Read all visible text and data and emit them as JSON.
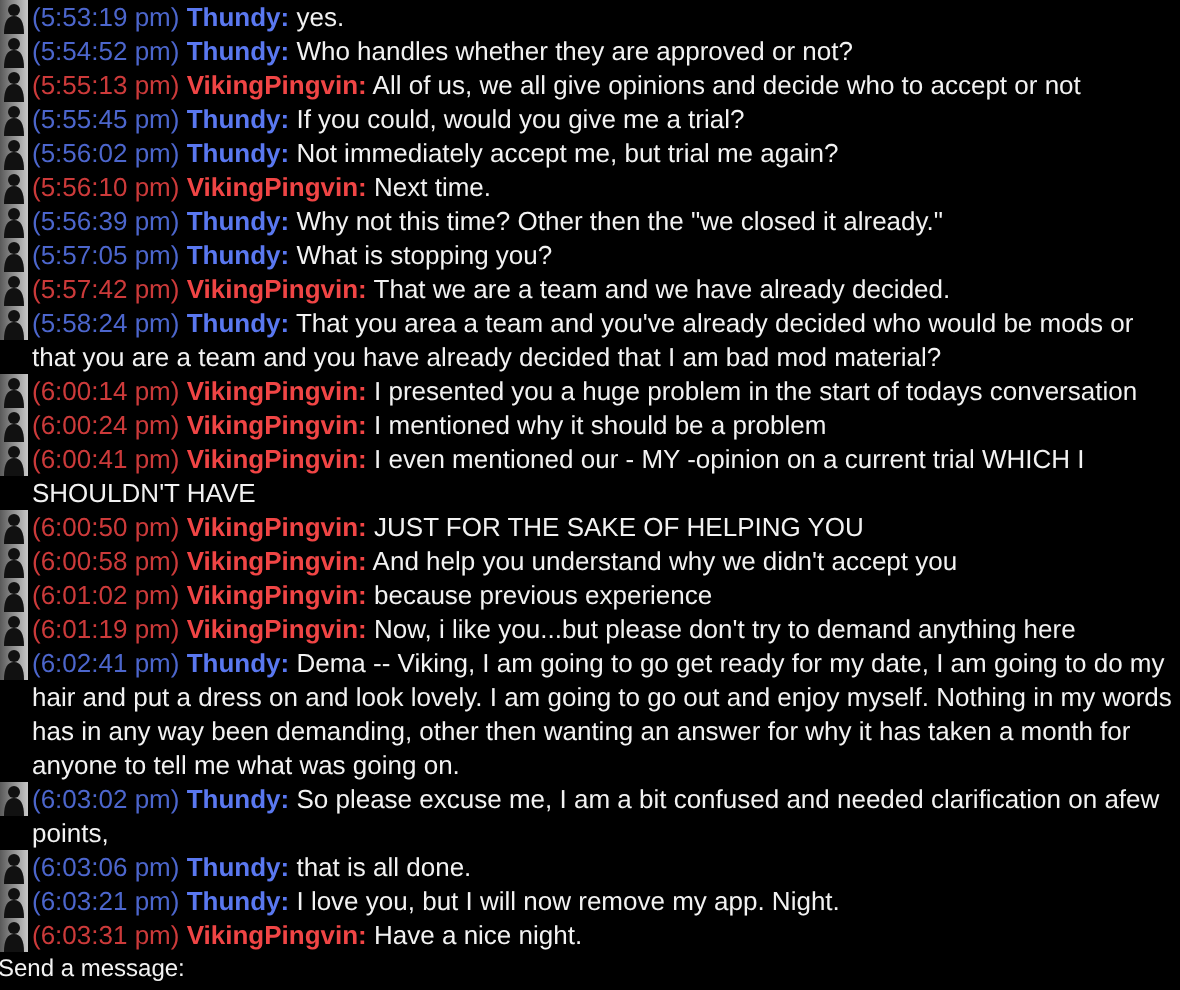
{
  "messages": [
    {
      "time": "(5:53:19 pm)",
      "sender": "Thundy:",
      "color": "#5a78f0",
      "text": "yes."
    },
    {
      "time": "(5:54:52 pm)",
      "sender": "Thundy:",
      "color": "#5a78f0",
      "text": "Who handles whether they are approved or not?"
    },
    {
      "time": "(5:55:13 pm)",
      "sender": "VikingPingvin:",
      "color": "#f04545",
      "text": "All of us, we all give opinions and decide who to accept or not"
    },
    {
      "time": "(5:55:45 pm)",
      "sender": "Thundy:",
      "color": "#5a78f0",
      "text": "If you could, would you give me a trial?"
    },
    {
      "time": "(5:56:02 pm)",
      "sender": "Thundy:",
      "color": "#5a78f0",
      "text": "Not immediately accept me, but trial me again?"
    },
    {
      "time": "(5:56:10 pm)",
      "sender": "VikingPingvin:",
      "color": "#f04545",
      "text": "Next time."
    },
    {
      "time": "(5:56:39 pm)",
      "sender": "Thundy:",
      "color": "#5a78f0",
      "text": "Why not this time? Other then the \"we closed it already.\""
    },
    {
      "time": "(5:57:05 pm)",
      "sender": "Thundy:",
      "color": "#5a78f0",
      "text": "What is stopping you?"
    },
    {
      "time": "(5:57:42 pm)",
      "sender": "VikingPingvin:",
      "color": "#f04545",
      "text": "That we are a team and we have already decided."
    },
    {
      "time": "(5:58:24 pm)",
      "sender": "Thundy:",
      "color": "#5a78f0",
      "text": "That you area a team and you've already decided who would be mods or that you are a team and you have already decided that I am bad mod material?"
    },
    {
      "time": "(6:00:14 pm)",
      "sender": "VikingPingvin:",
      "color": "#f04545",
      "text": "I presented you a huge problem in the start of todays conversation"
    },
    {
      "time": "(6:00:24 pm)",
      "sender": "VikingPingvin:",
      "color": "#f04545",
      "text": "I mentioned why it should be a problem"
    },
    {
      "time": "(6:00:41 pm)",
      "sender": "VikingPingvin:",
      "color": "#f04545",
      "text": "I even mentioned our - MY -opinion on a current trial WHICH I SHOULDN'T HAVE"
    },
    {
      "time": "(6:00:50 pm)",
      "sender": "VikingPingvin:",
      "color": "#f04545",
      "text": "JUST FOR THE SAKE OF HELPING YOU"
    },
    {
      "time": "(6:00:58 pm)",
      "sender": "VikingPingvin:",
      "color": "#f04545",
      "text": "And help you understand why we didn't accept you"
    },
    {
      "time": "(6:01:02 pm)",
      "sender": "VikingPingvin:",
      "color": "#f04545",
      "text": "because previous experience"
    },
    {
      "time": "(6:01:19 pm)",
      "sender": "VikingPingvin:",
      "color": "#f04545",
      "text": "Now, i like you...but please don't try to demand anything here"
    },
    {
      "time": "(6:02:41 pm)",
      "sender": "Thundy:",
      "color": "#5a78f0",
      "text": "Dema -- Viking, I am going to go get ready for my date, I am going to do my hair and put a dress on and look lovely. I am going to go out and enjoy myself. Nothing in my words has in any way been demanding, other then wanting an answer for why it has taken a month for anyone to tell me what was going on."
    },
    {
      "time": "(6:03:02 pm)",
      "sender": "Thundy:",
      "color": "#5a78f0",
      "text": "So please excuse me, I am a bit confused and needed clarification on afew points,"
    },
    {
      "time": "(6:03:06 pm)",
      "sender": "Thundy:",
      "color": "#5a78f0",
      "text": "that is all done."
    },
    {
      "time": "(6:03:21 pm)",
      "sender": "Thundy:",
      "color": "#5a78f0",
      "text": "I love you, but I will now remove my app. Night."
    },
    {
      "time": "(6:03:31 pm)",
      "sender": "VikingPingvin:",
      "color": "#f04545",
      "text": "Have a nice night."
    }
  ],
  "composer": {
    "label": "Send a message:"
  }
}
